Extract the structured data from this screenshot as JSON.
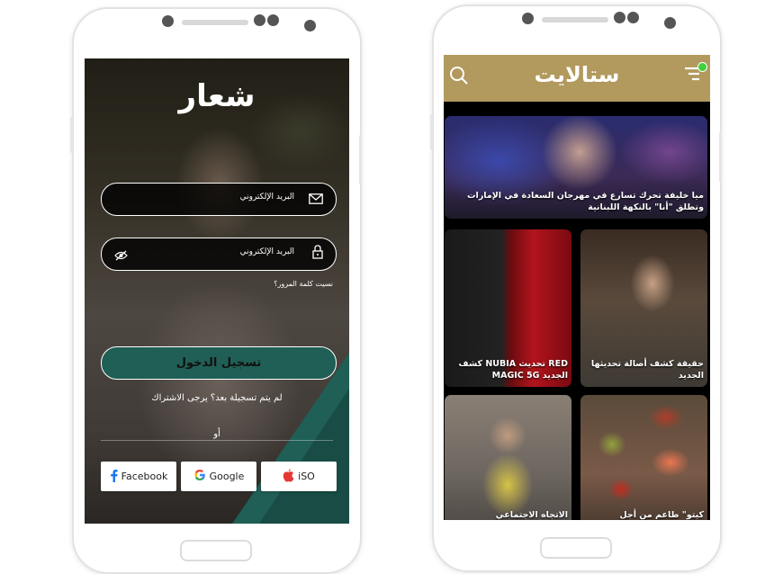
{
  "login_screen": {
    "logo": "شعار",
    "email_placeholder": "البريد الإلكتروني",
    "password_placeholder": "البريد الإلكتروني",
    "forgot_password": "نسيت كلمة المرور؟",
    "login_button": "تسجيل الدخول",
    "register_prompt": "لم يتم تسجيلة بعد؟ يرجى الاشتراك",
    "or_label": "أو",
    "social_buttons": [
      {
        "label": "Facebook",
        "icon": "facebook-icon",
        "color": "#1877f2"
      },
      {
        "label": "Google",
        "icon": "google-icon",
        "color": "#4285f4"
      },
      {
        "label": "iSO",
        "icon": "apple-icon",
        "color": "#e53935"
      }
    ],
    "accent_color": "#1f5f55"
  },
  "news_screen": {
    "brand_title": "ستالايت",
    "header_color": "#b29a5e",
    "articles": [
      {
        "caption": "ميا خليفة تحرك تسارع في مهرجان السعادة في الإمارات وتطلق \"أنا\" بالنكهة اللبنانية"
      },
      {
        "caption": "كشف NUBIA تحديث RED MAGIC 5G الجديد"
      },
      {
        "caption": "حقيقة كشف أصالة تحديثها الجديد"
      },
      {
        "caption": "الاتجاه الاجتماعي"
      },
      {
        "caption": "كيتو\" طاعم من أجل"
      }
    ]
  }
}
